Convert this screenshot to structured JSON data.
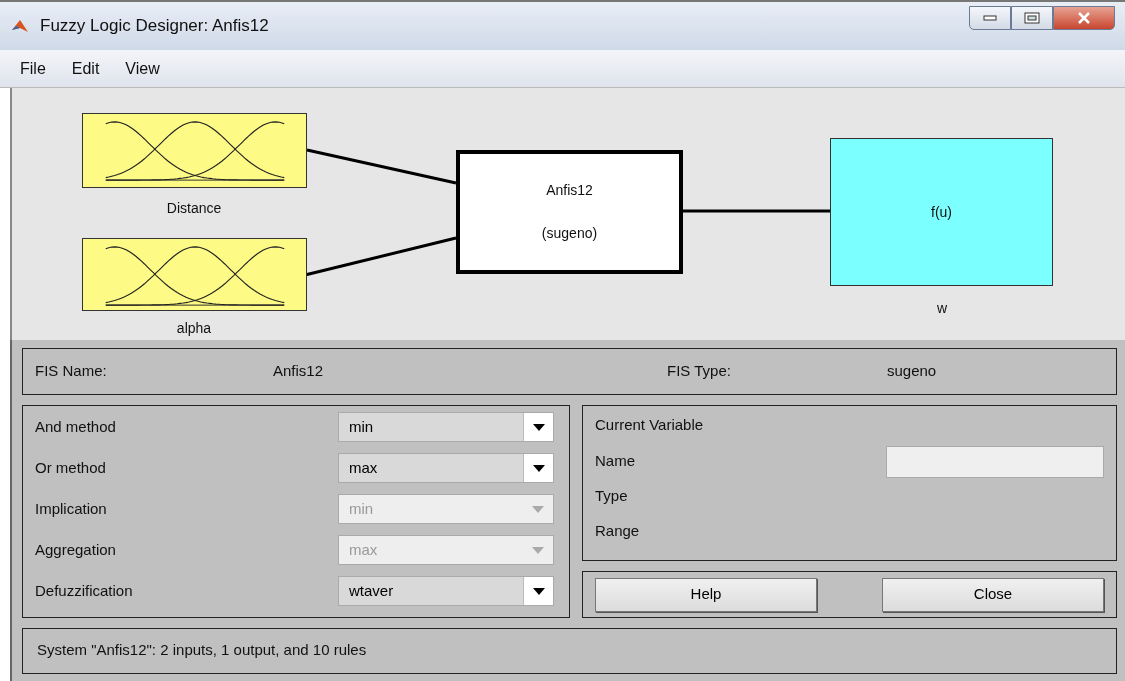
{
  "window": {
    "title": "Fuzzy Logic Designer: Anfis12"
  },
  "menu": [
    "File",
    "Edit",
    "View"
  ],
  "diagram": {
    "inputs": [
      {
        "name": "Distance"
      },
      {
        "name": "alpha"
      }
    ],
    "system": {
      "name": "Anfis12",
      "type": "(sugeno)"
    },
    "output": {
      "function": "f(u)",
      "name": "w"
    }
  },
  "fis": {
    "name_label": "FIS Name:",
    "name": "Anfis12",
    "type_label": "FIS Type:",
    "type": "sugeno"
  },
  "methods": [
    {
      "label": "And method",
      "value": "min",
      "disabled": false
    },
    {
      "label": "Or method",
      "value": "max",
      "disabled": false
    },
    {
      "label": "Implication",
      "value": "min",
      "disabled": true
    },
    {
      "label": "Aggregation",
      "value": "max",
      "disabled": true
    },
    {
      "label": "Defuzzification",
      "value": "wtaver",
      "disabled": false
    }
  ],
  "current_variable": {
    "title": "Current Variable",
    "fields": [
      {
        "label": "Name",
        "kind": "field"
      },
      {
        "label": "Type",
        "kind": "text"
      },
      {
        "label": "Range",
        "kind": "text"
      }
    ]
  },
  "buttons": [
    "Help",
    "Close"
  ],
  "status": "System \"Anfis12\": 2 inputs, 1 output, and 10 rules"
}
